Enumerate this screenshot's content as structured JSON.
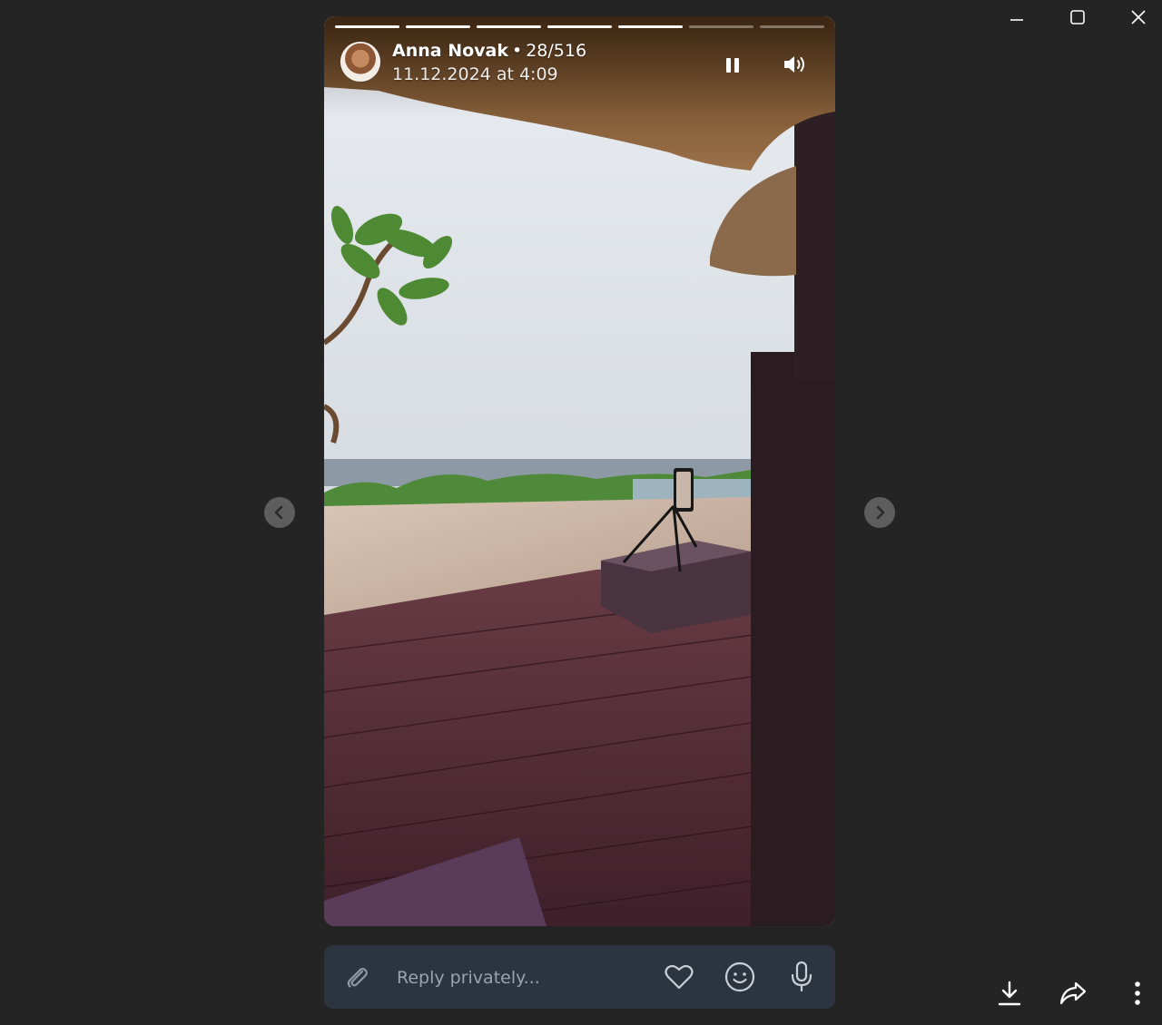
{
  "window": {
    "controls": [
      "minimize",
      "maximize",
      "close"
    ]
  },
  "story": {
    "author": "Anna Novak",
    "separator": "•",
    "position": "28/516",
    "timestamp": "11.12.2024 at 4:09",
    "progress": {
      "segments": 7,
      "completed": 5
    },
    "controls": {
      "pause_icon": "pause-icon",
      "volume_icon": "volume-icon"
    }
  },
  "navigation": {
    "prev_icon": "chevron-left-icon",
    "next_icon": "chevron-right-icon"
  },
  "reply": {
    "placeholder": "Reply privately...",
    "attach_icon": "paperclip-icon",
    "like_icon": "heart-icon",
    "emoji_icon": "smiley-icon",
    "voice_icon": "microphone-icon"
  },
  "actions": {
    "download_icon": "download-icon",
    "share_icon": "share-icon",
    "more_icon": "more-vertical-icon"
  },
  "colors": {
    "background": "#242424",
    "reply_bar": "#2c3440",
    "nav_button": "#5d5d5d"
  }
}
